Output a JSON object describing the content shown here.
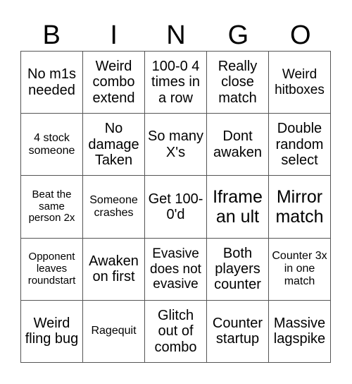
{
  "header": {
    "letters": [
      "B",
      "I",
      "N",
      "G",
      "O"
    ]
  },
  "cells": [
    [
      "No m1s needed",
      "Weird combo extend",
      "100-0 4 times in a row",
      "Really close match",
      "Weird hitboxes"
    ],
    [
      "4 stock someone",
      "No damage Taken",
      "So many X's",
      "Dont awaken",
      "Double random select"
    ],
    [
      "Beat the same person 2x",
      "Someone crashes",
      "Get 100-0'd",
      "Iframe an ult",
      "Mirror match"
    ],
    [
      "Opponent leaves roundstart",
      "Awaken on first",
      "Evasive does not evasive",
      "Both players counter",
      "Counter 3x in one match"
    ],
    [
      "Weird fling bug",
      "Ragequit",
      "Glitch out of combo",
      "Counter startup",
      "Massive lagspike"
    ]
  ]
}
